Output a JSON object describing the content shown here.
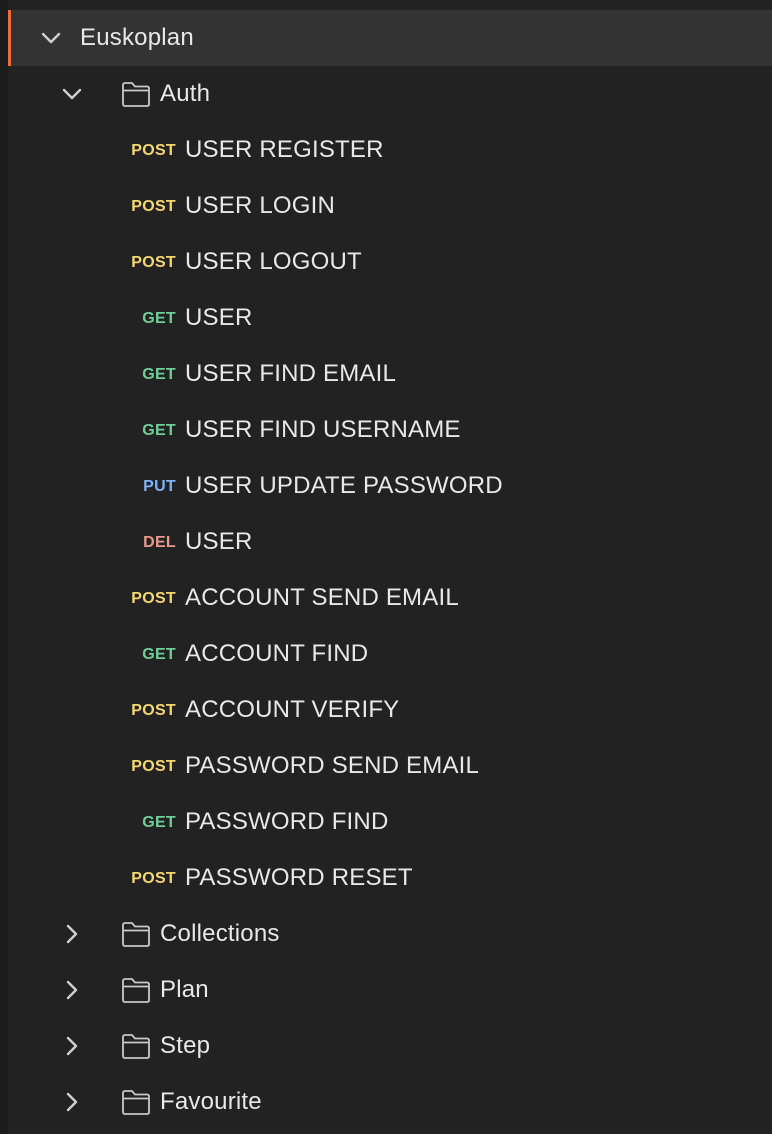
{
  "colors": {
    "background": "#222222",
    "collection_background": "#333333",
    "active_accent": "#f26b3a",
    "text": "#e8e8e8",
    "icon": "#c8c8c8",
    "POST": "#f5d76e",
    "GET": "#6fcf97",
    "PUT": "#7db3f5",
    "DEL": "#e89a8c"
  },
  "collection": {
    "name": "Euskoplan",
    "expanded": true,
    "icon": "chevron-down-icon"
  },
  "folders": [
    {
      "name": "Auth",
      "expanded": true,
      "icon": "folder-icon",
      "requests": [
        {
          "method": "POST",
          "name": "USER REGISTER"
        },
        {
          "method": "POST",
          "name": "USER LOGIN"
        },
        {
          "method": "POST",
          "name": "USER LOGOUT"
        },
        {
          "method": "GET",
          "name": "USER"
        },
        {
          "method": "GET",
          "name": "USER FIND EMAIL"
        },
        {
          "method": "GET",
          "name": "USER FIND USERNAME"
        },
        {
          "method": "PUT",
          "name": "USER UPDATE PASSWORD"
        },
        {
          "method": "DEL",
          "name": "USER"
        },
        {
          "method": "POST",
          "name": "ACCOUNT SEND EMAIL"
        },
        {
          "method": "GET",
          "name": "ACCOUNT FIND"
        },
        {
          "method": "POST",
          "name": "ACCOUNT VERIFY"
        },
        {
          "method": "POST",
          "name": "PASSWORD SEND EMAIL"
        },
        {
          "method": "GET",
          "name": "PASSWORD FIND"
        },
        {
          "method": "POST",
          "name": "PASSWORD RESET"
        }
      ]
    },
    {
      "name": "Collections",
      "expanded": false,
      "icon": "folder-icon",
      "requests": []
    },
    {
      "name": "Plan",
      "expanded": false,
      "icon": "folder-icon",
      "requests": []
    },
    {
      "name": "Step",
      "expanded": false,
      "icon": "folder-icon",
      "requests": []
    },
    {
      "name": "Favourite",
      "expanded": false,
      "icon": "folder-icon",
      "requests": []
    }
  ]
}
